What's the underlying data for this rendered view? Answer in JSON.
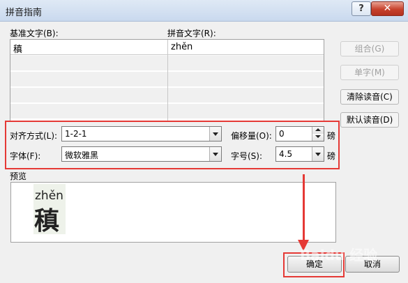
{
  "window": {
    "title": "拼音指南",
    "help_label": "?",
    "close_label": "✕"
  },
  "table": {
    "base_label": "基准文字(B):",
    "pinyin_label": "拼音文字(R):",
    "rows": [
      {
        "base": "稹",
        "pinyin": "zhěn"
      },
      {
        "base": "",
        "pinyin": ""
      },
      {
        "base": "",
        "pinyin": ""
      },
      {
        "base": "",
        "pinyin": ""
      },
      {
        "base": "",
        "pinyin": ""
      }
    ]
  },
  "side_buttons": {
    "combine": "组合(G)",
    "single": "单字(M)",
    "clear": "清除读音(C)",
    "default": "默认读音(D)"
  },
  "options": {
    "align_label": "对齐方式(L):",
    "align_value": "1-2-1",
    "offset_label": "偏移量(O):",
    "offset_value": "0",
    "offset_unit": "磅",
    "font_label": "字体(F):",
    "font_value": "微软雅黑",
    "size_label": "字号(S):",
    "size_value": "4.5",
    "size_unit": "磅"
  },
  "preview": {
    "label": "预览",
    "pinyin": "zhěn",
    "char": "稹"
  },
  "buttons": {
    "ok": "确定",
    "cancel": "取消"
  },
  "watermark": "Baidu 经验",
  "colors": {
    "highlight": "#e53935"
  }
}
